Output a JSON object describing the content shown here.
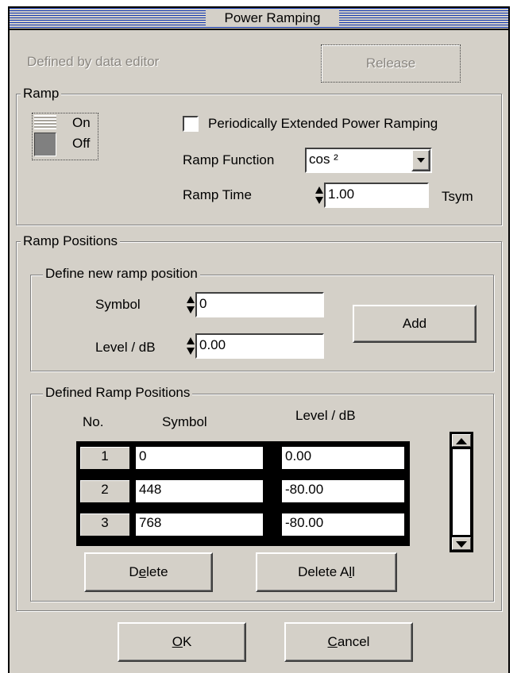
{
  "window": {
    "title": "Power Ramping"
  },
  "top": {
    "source_label": "Defined by data editor",
    "release_label": "Release"
  },
  "ramp": {
    "group_label": "Ramp",
    "switch_on": "On",
    "switch_off": "Off",
    "state": "Off",
    "extended_label": "Periodically Extended Power Ramping",
    "extended_checked": false,
    "function_label": "Ramp Function",
    "function_value": "cos ²",
    "time_label": "Ramp Time",
    "time_value": "1.00",
    "time_unit": "Tsym"
  },
  "positions": {
    "group_label": "Ramp Positions",
    "define_new": {
      "group_label": "Define new  ramp position",
      "symbol_label": "Symbol",
      "symbol_value": "0",
      "level_label": "Level / dB",
      "level_value": "0.00",
      "add_label": "Add"
    },
    "defined": {
      "group_label": "Defined Ramp Positions",
      "headers": {
        "no": "No.",
        "symbol": "Symbol",
        "level": "Level / dB"
      },
      "rows": [
        {
          "no": "1",
          "symbol": "0",
          "level": "0.00"
        },
        {
          "no": "2",
          "symbol": "448",
          "level": "-80.00"
        },
        {
          "no": "3",
          "symbol": "768",
          "level": "-80.00"
        }
      ],
      "delete_pre": "D",
      "delete_key": "e",
      "delete_post": "lete",
      "delete_all_pre": "Delete A",
      "delete_all_key": "l",
      "delete_all_post": "l"
    }
  },
  "footer": {
    "ok_key": "O",
    "ok_post": "K",
    "cancel_key": "C",
    "cancel_post": "ancel"
  },
  "colors": {
    "title_stripes": "#1238b2",
    "face": "#d4d0c8"
  }
}
